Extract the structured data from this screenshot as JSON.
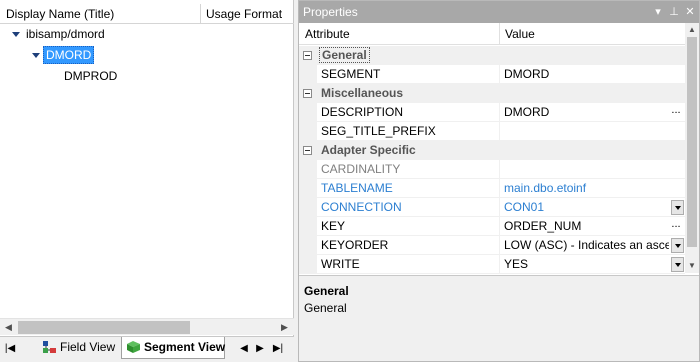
{
  "tree": {
    "columns": [
      "Display Name (Title)",
      "Usage Format"
    ],
    "nodes": [
      {
        "label": "ibisamp/dmord"
      },
      {
        "label": "DMORD"
      },
      {
        "label": "DMPROD"
      }
    ]
  },
  "tabs": {
    "field_view": "Field View",
    "segment_view": "Segment View"
  },
  "properties": {
    "title": "Properties",
    "columns": {
      "attribute": "Attribute",
      "value": "Value"
    },
    "categories": {
      "general": "General",
      "misc": "Miscellaneous",
      "adapter": "Adapter Specific"
    },
    "rows": {
      "segment": {
        "name": "SEGMENT",
        "value": "DMORD"
      },
      "description": {
        "name": "DESCRIPTION",
        "value": "DMORD"
      },
      "seg_title_prefix": {
        "name": "SEG_TITLE_PREFIX",
        "value": ""
      },
      "cardinality": {
        "name": "CARDINALITY",
        "value": ""
      },
      "tablename": {
        "name": "TABLENAME",
        "value": "main.dbo.etoinf"
      },
      "connection": {
        "name": "CONNECTION",
        "value": "CON01"
      },
      "key": {
        "name": "KEY",
        "value": "ORDER_NUM"
      },
      "keyorder": {
        "name": "KEYORDER",
        "value": "LOW (ASC) - Indicates an ascer"
      },
      "write": {
        "name": "WRITE",
        "value": "YES"
      }
    },
    "description_pane": {
      "title": "General",
      "text": "General"
    }
  },
  "colors": {
    "selection": "#3399ff",
    "link_blue": "#2c7fd1",
    "title_bar": "#a8a8a8"
  }
}
